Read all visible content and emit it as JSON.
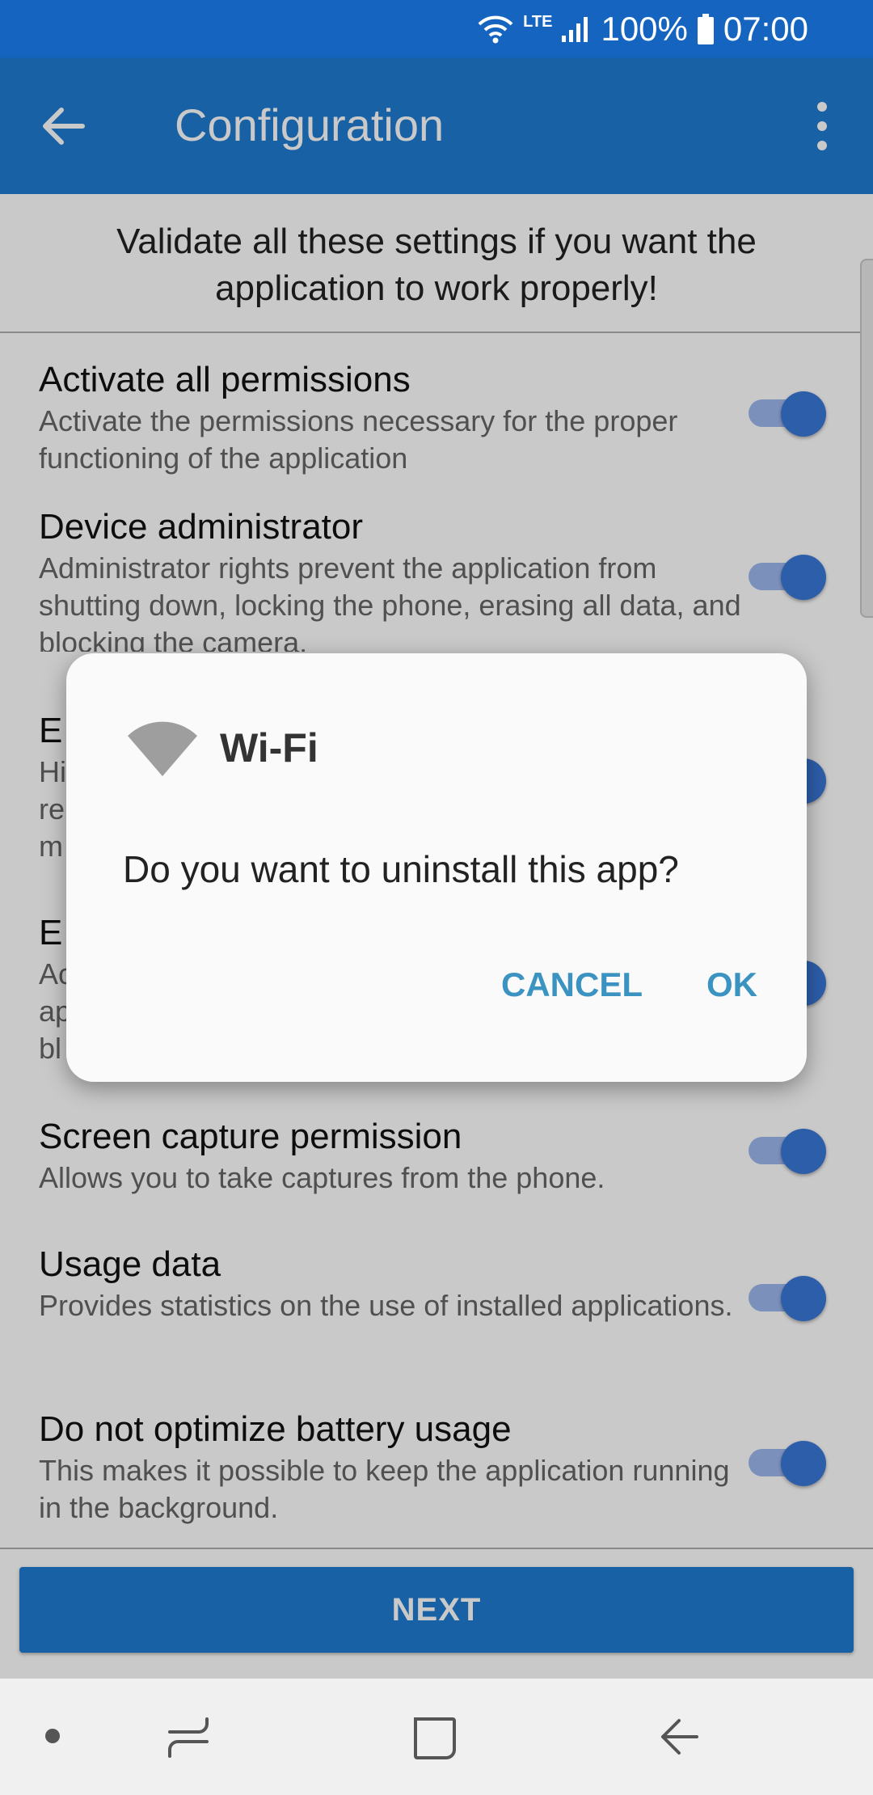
{
  "status_bar": {
    "lte": "LTE",
    "battery": "100%",
    "time": "07:00"
  },
  "app_bar": {
    "title": "Configuration"
  },
  "intro_text": "Validate all these settings if you want the application to work properly!",
  "settings": [
    {
      "title": "Activate all permissions",
      "desc": "Activate the permissions necessary for the proper functioning of the application",
      "enabled": true
    },
    {
      "title": "Device administrator",
      "desc": "Administrator rights prevent the application from shutting down, locking the phone, erasing all data, and blocking the camera.",
      "enabled": true
    },
    {
      "title": "E",
      "desc": "Hi re m",
      "enabled": true
    },
    {
      "title": "E",
      "desc": "Ac ap bl",
      "enabled": true
    },
    {
      "title": "Screen capture permission",
      "desc": "Allows you to take captures from the phone.",
      "enabled": true
    },
    {
      "title": "Usage data",
      "desc": "Provides statistics on the use of installed applications.",
      "enabled": true
    },
    {
      "title": "Do not optimize battery usage",
      "desc": "This makes it possible to keep the application running in the background.",
      "enabled": true
    }
  ],
  "next_button": "NEXT",
  "dialog": {
    "title": "Wi-Fi",
    "message": "Do you want to uninstall this app?",
    "cancel": "CANCEL",
    "ok": "OK"
  },
  "colors": {
    "primary": "#1e7bd0",
    "status_bar": "#1565c0",
    "toggle_on": "#3a78d8",
    "dialog_button": "#3a93c0"
  },
  "icons": [
    "wifi-icon",
    "signal-icon",
    "battery-icon",
    "arrow-back-icon",
    "more-vert-icon",
    "recent-apps-icon",
    "home-icon",
    "back-icon"
  ]
}
